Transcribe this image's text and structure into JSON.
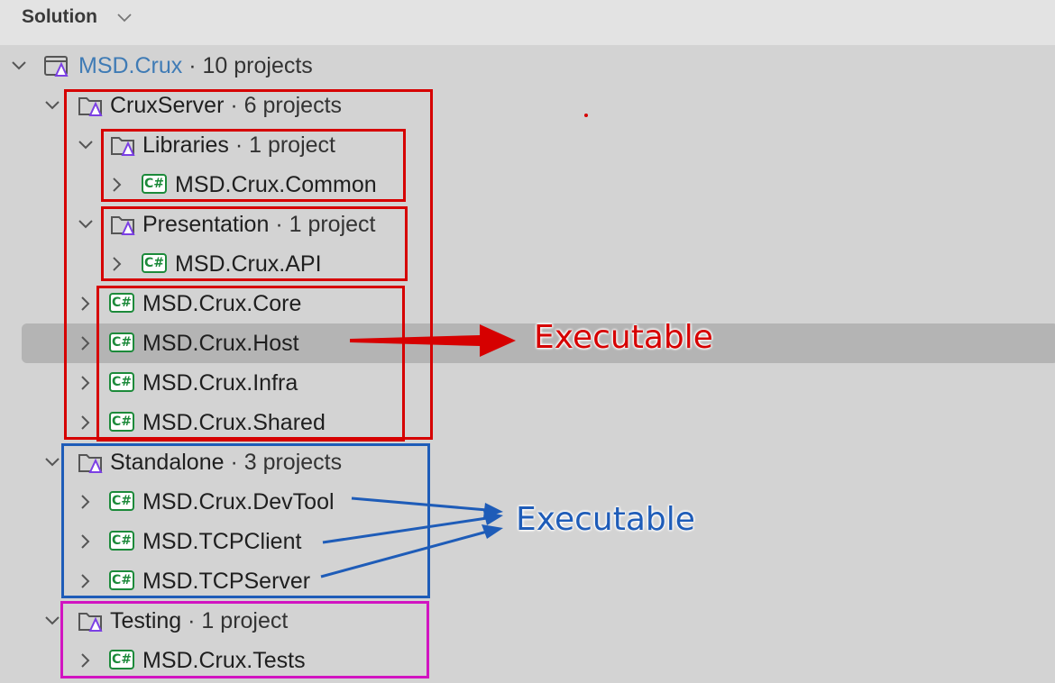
{
  "header": {
    "title": "Solution"
  },
  "tree": {
    "root": {
      "name": "MSD.Crux",
      "meta": " · 10 projects"
    },
    "rows": [
      {
        "id": "cruxserver",
        "name": "CruxServer",
        "meta": " · 6 projects"
      },
      {
        "id": "libraries",
        "name": "Libraries",
        "meta": " · 1 project"
      },
      {
        "id": "common",
        "name": "MSD.Crux.Common",
        "meta": ""
      },
      {
        "id": "presentation",
        "name": "Presentation",
        "meta": " · 1 project"
      },
      {
        "id": "api",
        "name": "MSD.Crux.API",
        "meta": ""
      },
      {
        "id": "core",
        "name": "MSD.Crux.Core",
        "meta": ""
      },
      {
        "id": "host",
        "name": "MSD.Crux.Host",
        "meta": ""
      },
      {
        "id": "infra",
        "name": "MSD.Crux.Infra",
        "meta": ""
      },
      {
        "id": "shared",
        "name": "MSD.Crux.Shared",
        "meta": ""
      },
      {
        "id": "standalone",
        "name": "Standalone",
        "meta": " · 3 projects"
      },
      {
        "id": "devtool",
        "name": "MSD.Crux.DevTool",
        "meta": ""
      },
      {
        "id": "tcpclient",
        "name": "MSD.TCPClient",
        "meta": ""
      },
      {
        "id": "tcpserver",
        "name": "MSD.TCPServer",
        "meta": ""
      },
      {
        "id": "testing",
        "name": "Testing",
        "meta": " · 1 project"
      },
      {
        "id": "tests",
        "name": "MSD.Crux.Tests",
        "meta": ""
      }
    ],
    "selected_row": "MSD.Crux.Host",
    "csharp_badge": "C#"
  },
  "annotations": {
    "red_label": "Executable",
    "blue_label": "Executable",
    "colors": {
      "red": "#d60000",
      "blue": "#1e5cb8",
      "magenta": "#d114c1"
    }
  },
  "icons": {
    "chevron_expanded": "chevron-down-icon",
    "chevron_collapsed": "chevron-right-icon",
    "folder": "solution-folder-icon",
    "solution": "solution-icon",
    "project": "csharp-project-icon"
  }
}
